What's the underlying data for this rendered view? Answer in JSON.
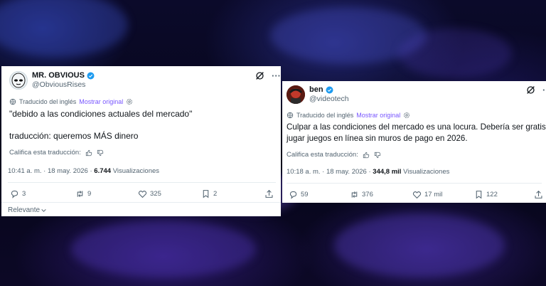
{
  "left_post": {
    "author_name": "MR. OBVIOUS",
    "handle": "@ObviousRises",
    "translated_label": "Traducido del inglés",
    "show_original": "Mostrar original",
    "text_line1": "\"debido a las condiciones actuales del mercado\"",
    "text_line2": "traducción: queremos MÁS dinero",
    "rate_label": "Califica esta traducción:",
    "timestamp": "10:41 a. m. · 18 may. 2026 ·",
    "views_count": "6.744",
    "views_label": "Visualizaciones",
    "replies": "3",
    "reposts": "9",
    "likes": "325",
    "bookmarks": "2",
    "sort_label": "Relevante"
  },
  "right_post": {
    "author_name": "ben",
    "handle": "@videotech",
    "translated_label": "Traducido del inglés",
    "show_original": "Mostrar original",
    "text_line1": "Culpar a las condiciones del mercado es una locura. Debería ser gratis",
    "text_line2": "jugar juegos en línea sin muros de pago en 2026.",
    "rate_label": "Califica esta traducción:",
    "timestamp": "10:18 a. m. · 18 may. 2026 ·",
    "views_count": "344,8 mil",
    "views_label": "Visualizaciones",
    "replies": "59",
    "reposts": "376",
    "likes": "17 mil",
    "bookmarks": "122"
  },
  "colors": {
    "verified": "#1d9bf0",
    "link": "#7856ff",
    "text_primary": "#0f1419",
    "text_secondary": "#536471",
    "background": "#07061a"
  },
  "icons": [
    "verified-badge-icon",
    "grok-icon",
    "more-icon",
    "globe-icon",
    "settings-icon",
    "thumbs-up-icon",
    "thumbs-down-icon",
    "reply-icon",
    "repost-icon",
    "like-icon",
    "bookmark-icon",
    "share-icon",
    "chevron-down-icon"
  ]
}
